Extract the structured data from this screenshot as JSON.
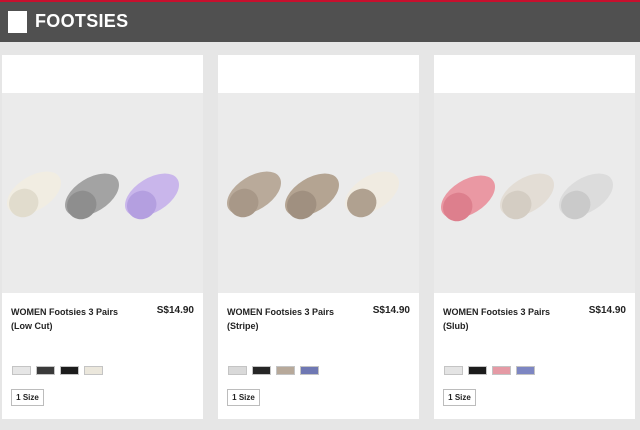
{
  "header": {
    "title": "FOOTSIES"
  },
  "products": [
    {
      "name_line1": "WOMEN Footsies 3 Pairs",
      "name_line2": "(Low Cut)",
      "price": "S$14.90",
      "size_label": "1 Size",
      "sock_colors": [
        [
          "#f1ede2",
          "#e1dccd"
        ],
        [
          "#a3a3a3",
          "#8e8e8e"
        ],
        [
          "#c9b6eb",
          "#b49fe0"
        ]
      ],
      "swatch_colors": [
        "#e6e6e6",
        "#3a3a3a",
        "#1c1c1c",
        "#ebe7dc"
      ]
    },
    {
      "name_line1": "WOMEN Footsies 3 Pairs",
      "name_line2": "(Stripe)",
      "price": "S$14.90",
      "size_label": "1 Size",
      "sock_colors": [
        [
          "#b9aa9a",
          "#a89888"
        ],
        [
          "#b4a492",
          "#a09080"
        ],
        [
          "#f0ebe1",
          "#b0a190"
        ]
      ],
      "swatch_colors": [
        "#d9d9d9",
        "#262626",
        "#b7a99a",
        "#6f78b3"
      ]
    },
    {
      "name_line1": "WOMEN Footsies 3 Pairs",
      "name_line2": "(Slub)",
      "price": "S$14.90",
      "size_label": "1 Size",
      "sock_colors": [
        [
          "#ea98a3",
          "#dd7f8d"
        ],
        [
          "#e3ddd5",
          "#d4cdc3"
        ],
        [
          "#dcdcdc",
          "#cacaca"
        ]
      ],
      "swatch_colors": [
        "#e4e4e4",
        "#1c1c1c",
        "#e59aa5",
        "#7d86c2"
      ]
    }
  ]
}
